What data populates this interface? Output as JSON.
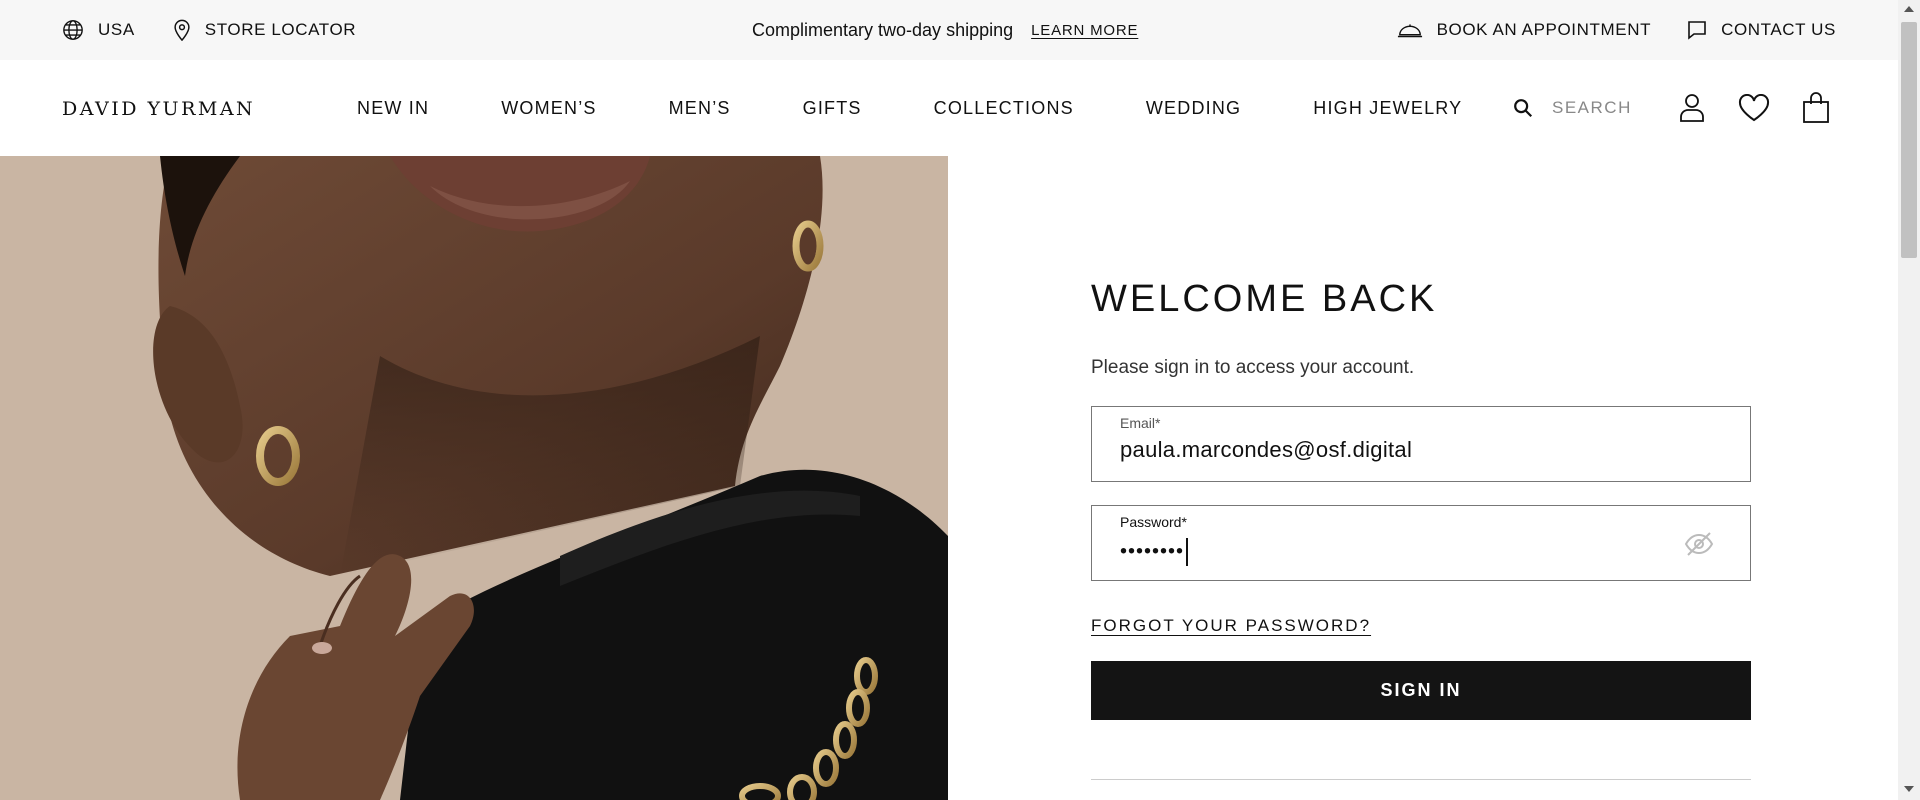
{
  "utility_bar": {
    "region_label": "USA",
    "store_locator_label": "STORE LOCATOR",
    "promo_message": "Complimentary two-day shipping",
    "learn_more_label": "LEARN MORE",
    "appointment_label": "BOOK AN APPOINTMENT",
    "contact_label": "CONTACT US"
  },
  "nav": {
    "logo": "DAVID YURMAN",
    "links": [
      "NEW IN",
      "WOMEN’S",
      "MEN’S",
      "GIFTS",
      "COLLECTIONS",
      "WEDDING",
      "HIGH JEWELRY"
    ],
    "search_placeholder": "SEARCH",
    "icons": [
      "search-icon",
      "account-icon",
      "wishlist-heart-icon",
      "shopping-bag-icon"
    ]
  },
  "login": {
    "title": "WELCOME BACK",
    "subtitle": "Please sign in to access your account.",
    "email_label": "Email*",
    "email_value": "paula.marcondes@osf.digital",
    "password_label": "Password*",
    "password_value": "••••••••",
    "forgot_label": "FORGOT YOUR PASSWORD?",
    "signin_label": "SIGN IN"
  },
  "colors": {
    "utility_bg": "#f7f7f7",
    "button_bg": "#141414",
    "text": "#111111"
  }
}
